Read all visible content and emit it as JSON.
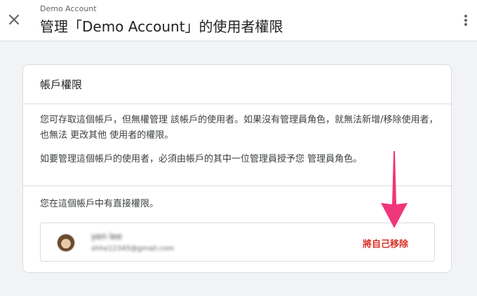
{
  "header": {
    "subtitle": "Demo Account",
    "title": "管理「Demo Account」的使用者權限",
    "close_icon": "close-icon",
    "more_icon": "more-vert-icon"
  },
  "card": {
    "title": "帳戶權限",
    "para1": "您可存取這個帳戶，但無權管理 該帳戶的使用者。如果沒有管理員角色，就無法新增/移除使用者，也無法 更改其他 使用者的權限。",
    "para2": "如要管理這個帳戶的使用者，必須由帳戶的其中一位管理員授予您 管理員角色。",
    "direct_permission_text": "您在這個帳戶中有直接權限。",
    "user": {
      "name": "yen lee",
      "email": "shhe12345@gmail.com",
      "remove_label": "將自己移除"
    }
  },
  "annotation": {
    "color": "#f0367a",
    "icon": "down-arrow"
  }
}
